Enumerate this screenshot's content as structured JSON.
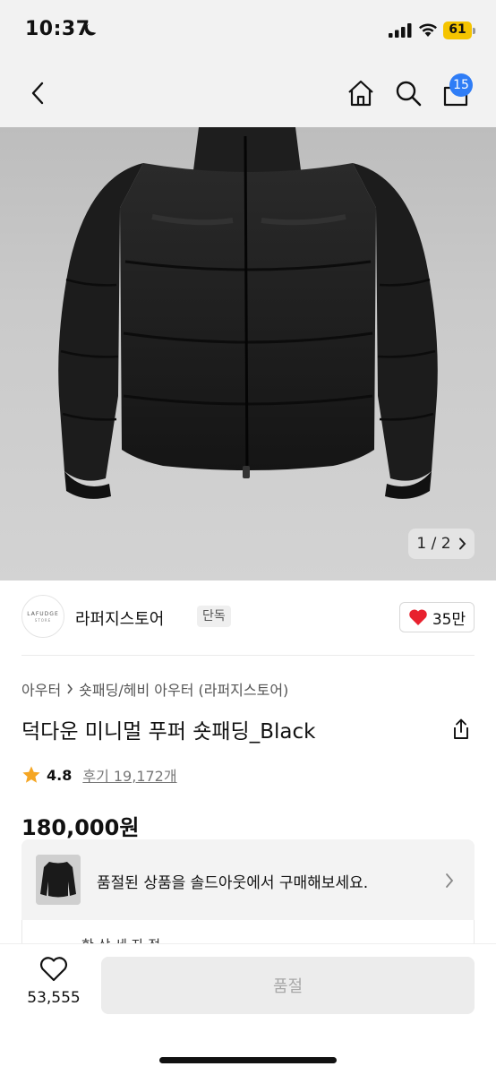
{
  "status_bar": {
    "time": "10:37",
    "battery": "61",
    "icons": [
      "moon-icon",
      "signal-icon",
      "wifi-icon",
      "battery-icon"
    ]
  },
  "header": {
    "icons": [
      "back-icon",
      "home-icon",
      "search-icon",
      "cart-icon"
    ],
    "cart_badge": "15",
    "badge_color": "#2f7df6"
  },
  "gallery": {
    "pager_current": "1",
    "pager_sep": "/",
    "pager_total": "2"
  },
  "store": {
    "logo_text": "LAFUDGE",
    "logo_sub": "STORE",
    "name": "라퍼지스토어",
    "tag": "단독",
    "likes": "35만",
    "heart_color": "#e8212e"
  },
  "product": {
    "breadcrumb": [
      "아우터",
      "숏패딩/헤비 아우터 (라퍼지스토어)"
    ],
    "title": "덕다운 미니멀 푸퍼 숏패딩_Black",
    "rating": "4.8",
    "review_text": "후기 19,172개",
    "star_color": "#f5a623",
    "price": "180,000원"
  },
  "soldout_card": {
    "text": "품절된 상품을 솔드아웃에서 구매해보세요.",
    "below_text": "한 상 세 자 정"
  },
  "bottom_bar": {
    "wish_count": "53,555",
    "buy_label": "품절"
  }
}
